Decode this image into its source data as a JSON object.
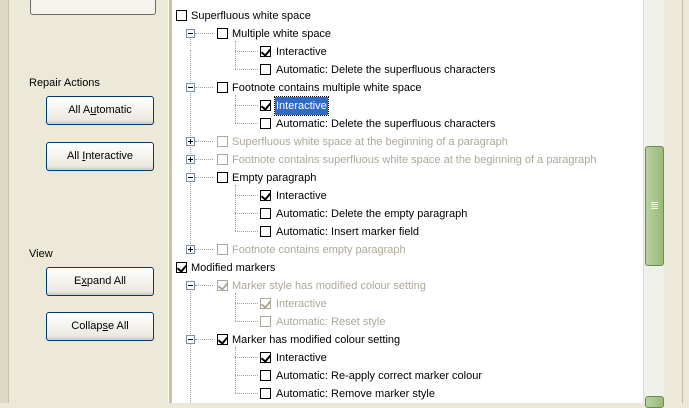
{
  "left_panel": {
    "repair_actions_label": "Repair Actions",
    "all_automatic": {
      "pre": "All A",
      "acc": "u",
      "post": "tomatic"
    },
    "all_interactive": {
      "pre": "All ",
      "acc": "I",
      "post": "nteractive"
    },
    "view_label": "View",
    "expand_all": {
      "pre": "E",
      "acc": "x",
      "post": "pand All"
    },
    "collapse_all": {
      "pre": "Collap",
      "acc": "s",
      "post": "e All"
    }
  },
  "tree": {
    "rows": [
      {
        "text": "Superfluous white space",
        "checked": false,
        "disabled": false
      },
      {
        "text": "Multiple white space",
        "checked": false,
        "disabled": false
      },
      {
        "text": "Interactive",
        "checked": true,
        "disabled": false
      },
      {
        "text": "Automatic: Delete the superfluous characters",
        "checked": false,
        "disabled": false
      },
      {
        "text": "Footnote contains multiple white space",
        "checked": false,
        "disabled": false
      },
      {
        "text": "Interactive",
        "checked": true,
        "disabled": false,
        "selected": true
      },
      {
        "text": "Automatic: Delete the superfluous characters",
        "checked": false,
        "disabled": false
      },
      {
        "text": "Superfluous white space at the beginning of a paragraph",
        "checked": false,
        "disabled": true
      },
      {
        "text": "Footnote contains superfluous white space at the beginning of a paragraph",
        "checked": false,
        "disabled": true
      },
      {
        "text": "Empty paragraph",
        "checked": false,
        "disabled": false
      },
      {
        "text": "Interactive",
        "checked": true,
        "disabled": false
      },
      {
        "text": "Automatic: Delete the empty paragraph",
        "checked": false,
        "disabled": false
      },
      {
        "text": "Automatic: Insert marker field",
        "checked": false,
        "disabled": false
      },
      {
        "text": "Footnote contains empty paragraph",
        "checked": false,
        "disabled": true
      },
      {
        "text": "Modified markers",
        "checked": true,
        "disabled": false
      },
      {
        "text": "Marker style has modified colour setting",
        "checked": true,
        "disabled": true
      },
      {
        "text": "Interactive",
        "checked": true,
        "disabled": true
      },
      {
        "text": "Automatic: Reset style",
        "checked": false,
        "disabled": true
      },
      {
        "text": "Marker has modified colour setting",
        "checked": true,
        "disabled": false
      },
      {
        "text": "Interactive",
        "checked": true,
        "disabled": false
      },
      {
        "text": "Automatic: Re-apply correct marker colour",
        "checked": false,
        "disabled": false
      },
      {
        "text": "Automatic: Remove marker style",
        "checked": false,
        "disabled": false
      }
    ]
  },
  "colors": {
    "accent_check": "#21a121",
    "disabled_text": "#aca899",
    "selection": "#316ac5",
    "scroll_thumb": "#9ab97a"
  }
}
